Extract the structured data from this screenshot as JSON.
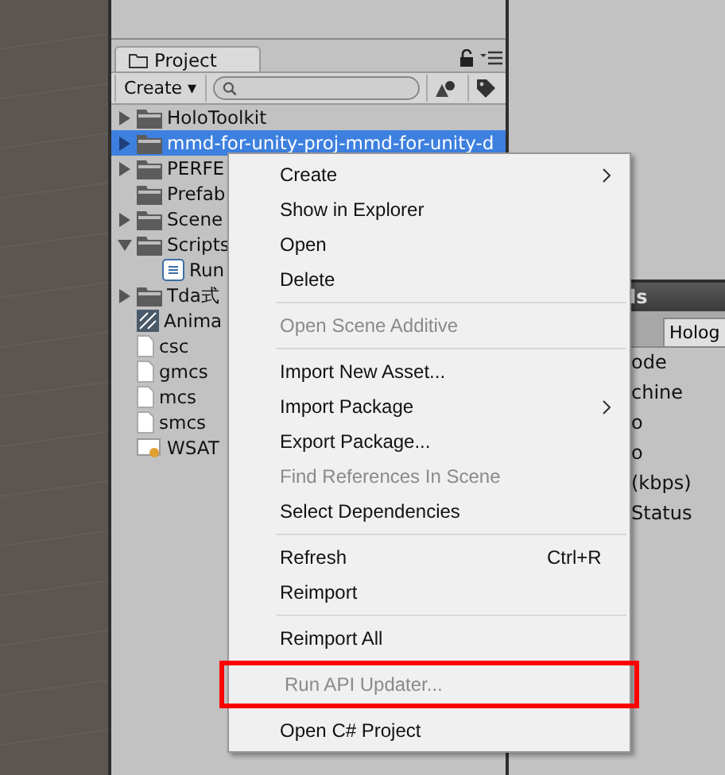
{
  "project_panel": {
    "tab": "Project",
    "create_button": "Create ▾",
    "tree": [
      {
        "label": "HoloToolkit",
        "kind": "folder",
        "expanded": false,
        "selected": false
      },
      {
        "label": "mmd-for-unity-proj-mmd-for-unity-d",
        "kind": "folder",
        "expanded": false,
        "selected": true
      },
      {
        "label": "PERFE",
        "kind": "folder",
        "expanded": false,
        "selected": false
      },
      {
        "label": "Prefab",
        "kind": "leaf-folder",
        "selected": false
      },
      {
        "label": "Scene",
        "kind": "folder",
        "expanded": false,
        "selected": false
      },
      {
        "label": "Scripts",
        "kind": "folder",
        "expanded": true,
        "selected": false,
        "children": [
          {
            "label": "Run",
            "kind": "script",
            "selected": false
          }
        ]
      },
      {
        "label": "Tda式",
        "kind": "folder",
        "expanded": false,
        "selected": false
      },
      {
        "label": "Anima",
        "kind": "anim",
        "selected": false
      },
      {
        "label": "csc",
        "kind": "file",
        "selected": false
      },
      {
        "label": "gmcs",
        "kind": "file",
        "selected": false
      },
      {
        "label": "mcs",
        "kind": "file",
        "selected": false
      },
      {
        "label": "smcs",
        "kind": "file",
        "selected": false
      },
      {
        "label": "WSAT",
        "kind": "cert",
        "selected": false
      }
    ]
  },
  "right_panel": {
    "title": "ls",
    "tab": "Holog",
    "rows": [
      "ode",
      "chine",
      "o",
      "o",
      "(kbps)",
      "Status"
    ]
  },
  "context_menu": [
    {
      "kind": "item",
      "label": "Create",
      "submenu": true,
      "disabled": false,
      "highlighted": false
    },
    {
      "kind": "item",
      "label": "Show in Explorer",
      "submenu": false,
      "disabled": false,
      "highlighted": false
    },
    {
      "kind": "item",
      "label": "Open",
      "submenu": false,
      "disabled": false,
      "highlighted": false
    },
    {
      "kind": "item",
      "label": "Delete",
      "submenu": false,
      "disabled": false,
      "highlighted": false
    },
    {
      "kind": "separator"
    },
    {
      "kind": "item",
      "label": "Open Scene Additive",
      "submenu": false,
      "disabled": true,
      "highlighted": false
    },
    {
      "kind": "separator"
    },
    {
      "kind": "item",
      "label": "Import New Asset...",
      "submenu": false,
      "disabled": false,
      "highlighted": false
    },
    {
      "kind": "item",
      "label": "Import Package",
      "submenu": true,
      "disabled": false,
      "highlighted": false
    },
    {
      "kind": "item",
      "label": "Export Package...",
      "submenu": false,
      "disabled": false,
      "highlighted": false
    },
    {
      "kind": "item",
      "label": "Find References In Scene",
      "submenu": false,
      "disabled": true,
      "highlighted": false
    },
    {
      "kind": "item",
      "label": "Select Dependencies",
      "submenu": false,
      "disabled": false,
      "highlighted": false
    },
    {
      "kind": "separator"
    },
    {
      "kind": "item",
      "label": "Refresh",
      "shortcut": "Ctrl+R",
      "submenu": false,
      "disabled": false,
      "highlighted": false
    },
    {
      "kind": "item",
      "label": "Reimport",
      "submenu": false,
      "disabled": false,
      "highlighted": false
    },
    {
      "kind": "separator"
    },
    {
      "kind": "item",
      "label": "Reimport All",
      "submenu": false,
      "disabled": false,
      "highlighted": false
    },
    {
      "kind": "item",
      "label": "Run API Updater...",
      "submenu": false,
      "disabled": true,
      "highlighted": true
    },
    {
      "kind": "item",
      "label": "Open C# Project",
      "submenu": false,
      "disabled": false,
      "highlighted": false
    }
  ]
}
